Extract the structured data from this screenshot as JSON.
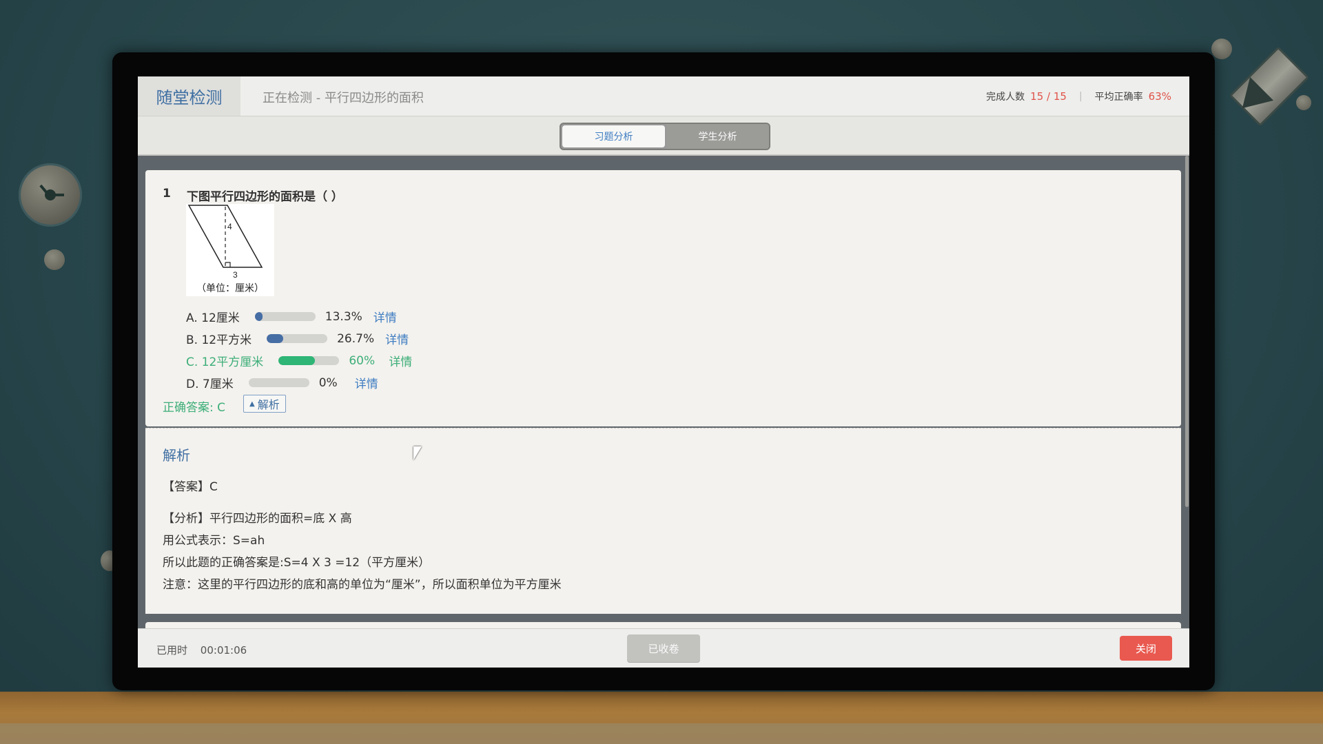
{
  "header": {
    "app_title": "随堂检测",
    "subtitle": "正在检测 - 平行四边形的面积",
    "completed_label": "完成人数",
    "completed_value": "15 / 15",
    "separator": "|",
    "avg_label": "平均正确率",
    "avg_value": "63%"
  },
  "tabs": [
    {
      "label": "习题分析",
      "active": true
    },
    {
      "label": "学生分析",
      "active": false
    }
  ],
  "question": {
    "number": "1",
    "text": "下图平行四边形的面积是（ ）",
    "figure": {
      "height_label": "4",
      "base_label": "3",
      "unit_label": "（单位：厘米）"
    },
    "options": [
      {
        "label": "A. 12厘米",
        "percent": 13.3,
        "percent_text": "13.3%",
        "detail": "详情",
        "correct": false
      },
      {
        "label": "B. 12平方米",
        "percent": 26.7,
        "percent_text": "26.7%",
        "detail": "详情",
        "correct": false
      },
      {
        "label": "C. 12平方厘米",
        "percent": 60,
        "percent_text": "60%",
        "detail": "详情",
        "correct": true
      },
      {
        "label": "D. 7厘米",
        "percent": 0,
        "percent_text": "0%",
        "detail": "详情",
        "correct": false
      }
    ],
    "answer_text": "正确答案: C",
    "explain_button": "解析"
  },
  "analysis": {
    "title": "解析",
    "lines": [
      "【答案】C",
      "【分析】平行四边形的面积=底 X 高",
      "用公式表示：S=ah",
      "所以此题的正确答案是:S=4 X 3 =12（平方厘米）",
      "注意：这里的平行四边形的底和高的单位为“厘米”，所以面积单位为平方厘米"
    ]
  },
  "footer": {
    "elapsed_label": "已用时",
    "elapsed_value": "00:01:06",
    "collected_button": "已收卷",
    "close_button": "关闭"
  },
  "colors": {
    "accent_blue": "#3f7dc2",
    "correct_green": "#3cae78",
    "danger_red": "#e9594f",
    "bar_blue": "#466ea4"
  },
  "icons": [
    "clock-icon",
    "pencil-icon",
    "triangle-up-icon",
    "mouse-cursor-icon"
  ]
}
